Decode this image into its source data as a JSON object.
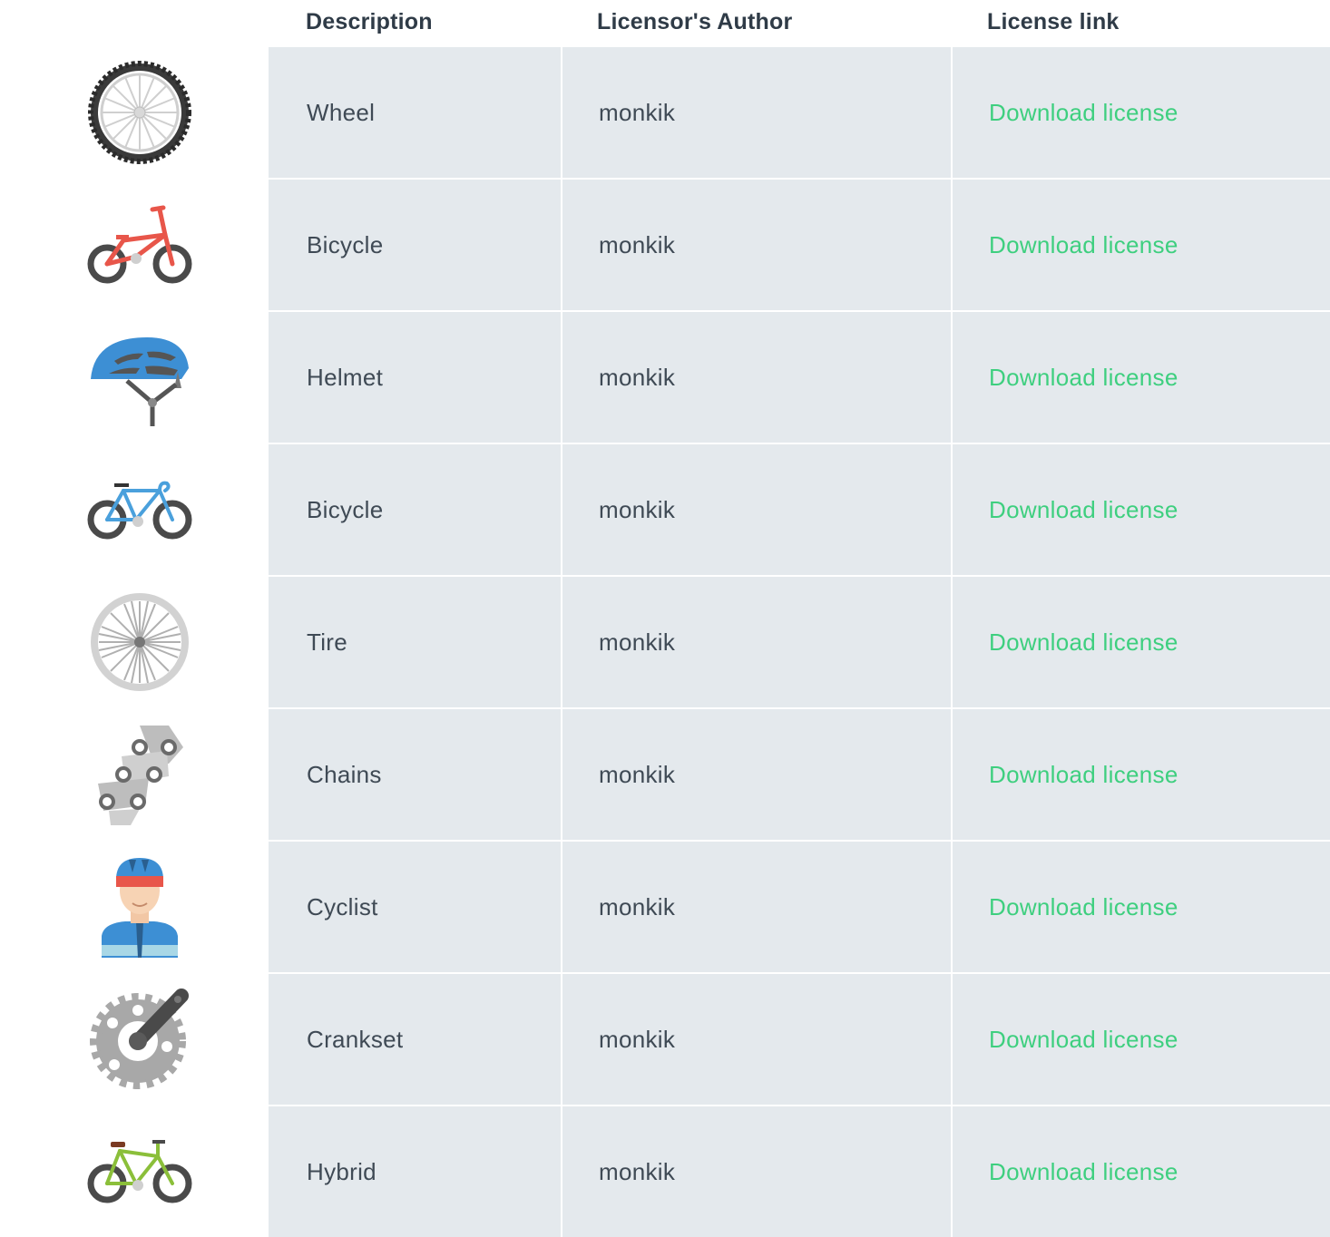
{
  "header": {
    "description": "Description",
    "author": "Licensor's Author",
    "license": "License link"
  },
  "rows": [
    {
      "icon": "mountain-wheel-icon",
      "description": "Wheel",
      "author": "monkik",
      "link": "Download license"
    },
    {
      "icon": "bmx-bicycle-icon",
      "description": "Bicycle",
      "author": "monkik",
      "link": "Download license"
    },
    {
      "icon": "helmet-icon",
      "description": "Helmet",
      "author": "monkik",
      "link": "Download license"
    },
    {
      "icon": "road-bicycle-icon",
      "description": "Bicycle",
      "author": "monkik",
      "link": "Download license"
    },
    {
      "icon": "tire-icon",
      "description": "Tire",
      "author": "monkik",
      "link": "Download license"
    },
    {
      "icon": "chain-icon",
      "description": "Chains",
      "author": "monkik",
      "link": "Download license"
    },
    {
      "icon": "cyclist-icon",
      "description": "Cyclist",
      "author": "monkik",
      "link": "Download license"
    },
    {
      "icon": "crankset-icon",
      "description": "Crankset",
      "author": "monkik",
      "link": "Download license"
    },
    {
      "icon": "hybrid-bicycle-icon",
      "description": "Hybrid",
      "author": "monkik",
      "link": "Download license"
    }
  ],
  "colors": {
    "cell_bg": "#e4e9ed",
    "link": "#3ecf7f",
    "text": "#3f4a55",
    "bmx_frame": "#e8564a",
    "road_frame": "#4aa0dc",
    "hybrid_frame": "#8bbf3a"
  }
}
